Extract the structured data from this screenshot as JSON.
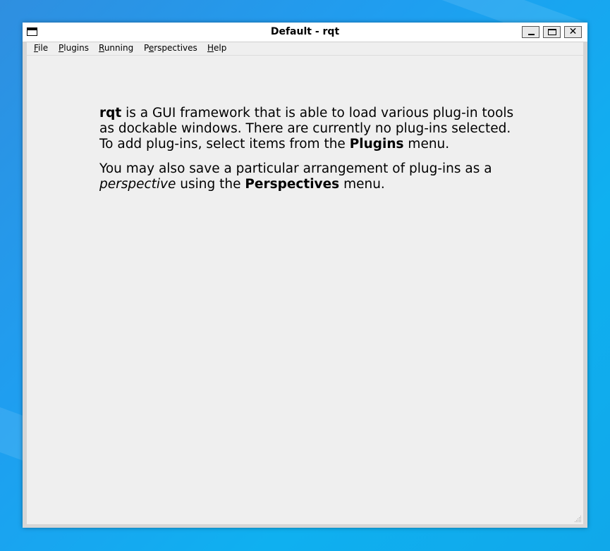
{
  "window": {
    "title": "Default - rqt",
    "buttons": {
      "minimize": "minimize",
      "maximize": "maximize",
      "close": "✕"
    }
  },
  "menubar": {
    "items": [
      {
        "accel": "F",
        "rest": "ile"
      },
      {
        "accel": "P",
        "rest": "lugins"
      },
      {
        "accel": "R",
        "rest": "unning"
      },
      {
        "pre": "P",
        "accel": "e",
        "rest": "rspectives"
      },
      {
        "accel": "H",
        "rest": "elp"
      }
    ]
  },
  "content": {
    "p1": {
      "bold_start": "rqt",
      "text": " is a GUI framework that is able to load various plug-in tools as dockable windows. There are currently no plug-ins selected. To add plug-ins, select items from the ",
      "bold_end": "Plugins",
      "tail": " menu."
    },
    "p2": {
      "text": "You may also save a particular arrangement of plug-ins as a ",
      "italic": "perspective",
      "mid": " using the ",
      "bold": "Perspectives",
      "tail": " menu."
    }
  },
  "colors": {
    "desktop": "#1f9ef0",
    "window_bg": "#efefef",
    "titlebar": "#ffffff"
  },
  "icons": [
    "app-window-icon",
    "minimize-icon",
    "maximize-icon",
    "close-icon",
    "resize-grip-icon"
  ]
}
